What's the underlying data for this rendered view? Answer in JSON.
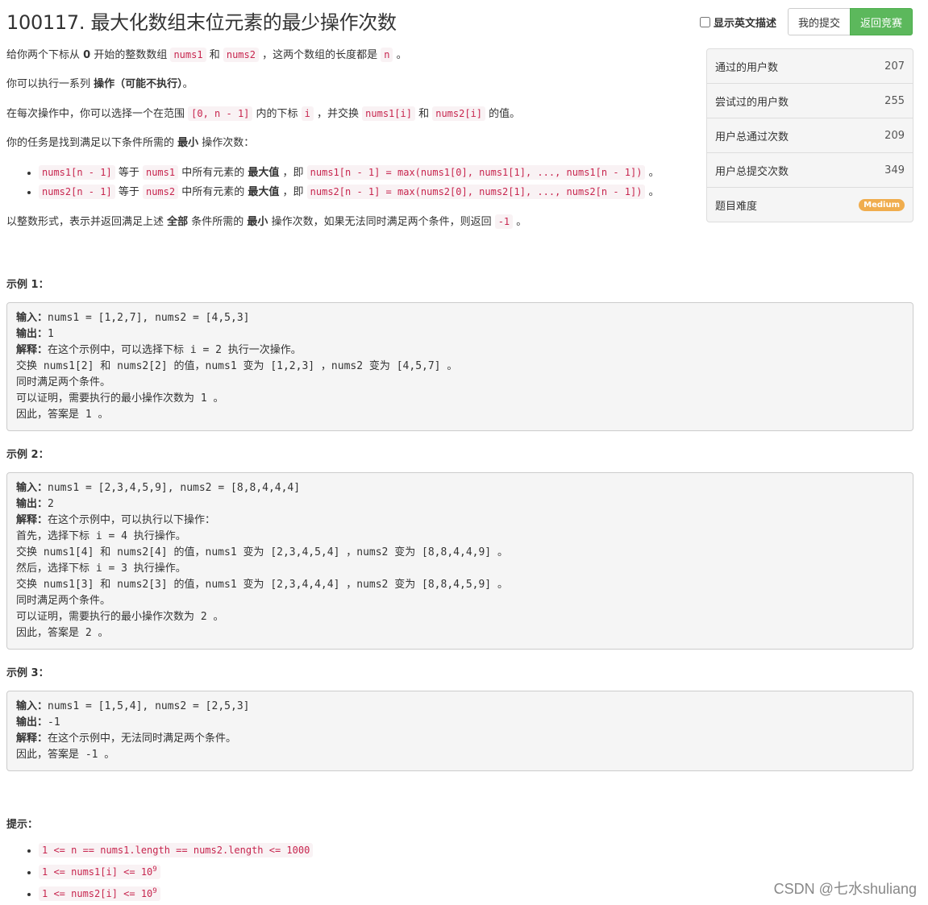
{
  "title": "100117. 最大化数组末位元素的最少操作次数",
  "toolbar": {
    "toggle_label": "显示英文描述",
    "my_submissions": "我的提交",
    "back_to_contest": "返回竞赛"
  },
  "stats": [
    {
      "label": "通过的用户数",
      "value": "207"
    },
    {
      "label": "尝试过的用户数",
      "value": "255"
    },
    {
      "label": "用户总通过次数",
      "value": "209"
    },
    {
      "label": "用户总提交次数",
      "value": "349"
    },
    {
      "label": "题目难度",
      "value": "Medium"
    }
  ],
  "desc": {
    "p1": {
      "a": "给你两个下标从 ",
      "b": "0",
      "c": " 开始的整数数组 ",
      "d": "nums1",
      "e": " 和 ",
      "f": "nums2",
      "g": " ，这两个数组的长度都是 ",
      "h": "n",
      "i": " 。"
    },
    "p2": {
      "a": "你可以执行一系列 ",
      "b": "操作（可能不执行）",
      "c": "。"
    },
    "p3": {
      "a": "在每次操作中，你可以选择一个在范围 ",
      "b": "[0, n - 1]",
      "c": " 内的下标 ",
      "d": "i",
      "e": " ，并交换 ",
      "f": "nums1[i]",
      "g": " 和 ",
      "h": "nums2[i]",
      "i": " 的值。"
    },
    "p4": {
      "a": "你的任务是找到满足以下条件所需的 ",
      "b": "最小",
      "c": " 操作次数："
    },
    "bullets": [
      {
        "a": "nums1[n - 1]",
        "b": " 等于 ",
        "c": "nums1",
        "d": " 中所有元素的 ",
        "e": "最大值",
        "f": " ，即 ",
        "g": "nums1[n - 1] = max(nums1[0], nums1[1], ..., nums1[n - 1])",
        "h": " 。"
      },
      {
        "a": "nums2[n - 1]",
        "b": " 等于 ",
        "c": "nums2",
        "d": " 中所有元素的 ",
        "e": "最大值",
        "f": " ，即 ",
        "g": "nums2[n - 1] = max(nums2[0], nums2[1], ..., nums2[n - 1])",
        "h": " 。"
      }
    ],
    "p5": {
      "a": "以整数形式，表示并返回满足上述 ",
      "b": "全部",
      "c": " 条件所需的 ",
      "d": "最小",
      "e": " 操作次数，如果无法同时满足两个条件，则返回 ",
      "f": "-1",
      "g": " 。"
    }
  },
  "examples": [
    {
      "label": "示例 1：",
      "input_label": "输入：",
      "input": "nums1 = [1,2,7], nums2 = [4,5,3]",
      "output_label": "输出：",
      "output": "1",
      "explain_label": "解释：",
      "explain": "在这个示例中，可以选择下标 i = 2 执行一次操作。",
      "lines": [
        "交换 nums1[2] 和 nums2[2] 的值，nums1 变为 [1,2,3] ，nums2 变为 [4,5,7] 。",
        "同时满足两个条件。",
        "可以证明，需要执行的最小操作次数为 1 。",
        "因此，答案是 1 。"
      ]
    },
    {
      "label": "示例 2：",
      "input_label": "输入：",
      "input": "nums1 = [2,3,4,5,9], nums2 = [8,8,4,4,4]",
      "output_label": "输出：",
      "output": "2",
      "explain_label": "解释：",
      "explain": "在这个示例中，可以执行以下操作：",
      "lines": [
        "首先，选择下标 i = 4 执行操作。",
        "交换 nums1[4] 和 nums2[4] 的值，nums1 变为 [2,3,4,5,4] ，nums2 变为 [8,8,4,4,9] 。",
        "然后，选择下标 i = 3 执行操作。",
        "交换 nums1[3] 和 nums2[3] 的值，nums1 变为 [2,3,4,4,4] ，nums2 变为 [8,8,4,5,9] 。",
        "同时满足两个条件。",
        "可以证明，需要执行的最小操作次数为 2 。",
        "因此，答案是 2 。"
      ]
    },
    {
      "label": "示例 3：",
      "input_label": "输入：",
      "input": "nums1 = [1,5,4], nums2 = [2,5,3]",
      "output_label": "输出：",
      "output": "-1",
      "explain_label": "解释：",
      "explain": "在这个示例中，无法同时满足两个条件。",
      "lines": [
        "因此，答案是 -1 。"
      ]
    }
  ],
  "hints": {
    "label": "提示：",
    "items": [
      {
        "text": "1 <= n == nums1.length == nums2.length <= 1000",
        "sup": ""
      },
      {
        "text": "1 <= nums1[i] <= 10",
        "sup": "9"
      },
      {
        "text": "1 <= nums2[i] <= 10",
        "sup": "9"
      }
    ]
  },
  "watermark": "CSDN @七水shuliang"
}
